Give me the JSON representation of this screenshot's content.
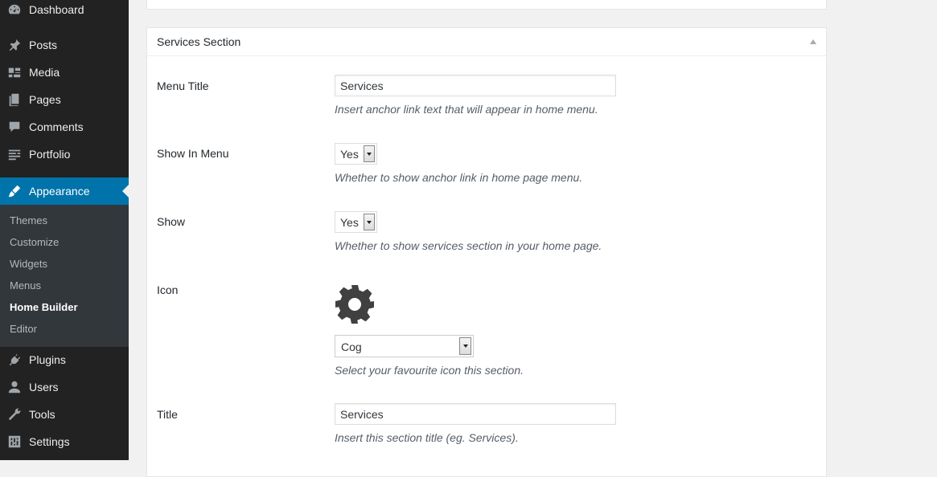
{
  "sidebar": {
    "items": [
      {
        "label": "Dashboard",
        "icon": "dashboard-icon"
      },
      {
        "label": "Posts",
        "icon": "pin-icon"
      },
      {
        "label": "Media",
        "icon": "media-icon"
      },
      {
        "label": "Pages",
        "icon": "pages-icon"
      },
      {
        "label": "Comments",
        "icon": "comment-icon"
      },
      {
        "label": "Portfolio",
        "icon": "portfolio-icon"
      },
      {
        "label": "Appearance",
        "icon": "brush-icon"
      },
      {
        "label": "Plugins",
        "icon": "plug-icon"
      },
      {
        "label": "Users",
        "icon": "user-icon"
      },
      {
        "label": "Tools",
        "icon": "wrench-icon"
      },
      {
        "label": "Settings",
        "icon": "settings-icon"
      }
    ],
    "active_item": "Appearance",
    "submenu": [
      "Themes",
      "Customize",
      "Widgets",
      "Menus",
      "Home Builder",
      "Editor"
    ],
    "current_submenu": "Home Builder"
  },
  "section": {
    "title": "Services Section",
    "fields": {
      "menu_title": {
        "label": "Menu Title",
        "value": "Services",
        "description": "Insert anchor link text that will appear in home menu."
      },
      "show_in_menu": {
        "label": "Show In Menu",
        "value": "Yes",
        "description": "Whether to show anchor link in home page menu."
      },
      "show": {
        "label": "Show",
        "value": "Yes",
        "description": "Whether to show services section in your home page."
      },
      "icon": {
        "label": "Icon",
        "value": "Cog",
        "preview_icon": "cog-icon",
        "description": "Select your favourite icon this section."
      },
      "title": {
        "label": "Title",
        "value": "Services",
        "description": "Insert this section title (eg. Services)."
      }
    }
  },
  "colors": {
    "sidebar_bg": "#222222",
    "submenu_bg": "#32373c",
    "active_bg": "#0073aa",
    "page_bg": "#f1f1f1"
  }
}
